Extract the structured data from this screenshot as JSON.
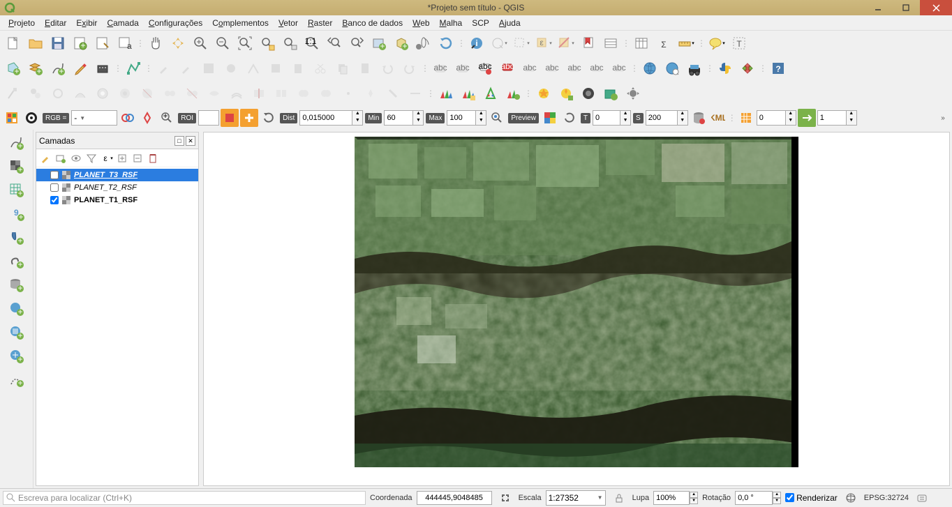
{
  "window": {
    "title": "*Projeto sem título - QGIS"
  },
  "menu": {
    "projeto": "Projeto",
    "editar": "Editar",
    "exibir": "Exibir",
    "camada": "Camada",
    "configuracoes": "Configurações",
    "complementos": "Complementos",
    "vetor": "Vetor",
    "raster": "Raster",
    "banco": "Banco de dados",
    "web": "Web",
    "malha": "Malha",
    "scp": "SCP",
    "ajuda": "Ajuda"
  },
  "scpbar": {
    "rgb_btn": "RGB =",
    "rgb_val": "-",
    "roi_btn": "ROI",
    "dist_label": "Dist",
    "dist_val": "0,015000",
    "min_label": "Min",
    "min_val": "60",
    "max_label": "Max",
    "max_val": "100",
    "preview_btn": "Preview",
    "t_label": "T",
    "t_val": "0",
    "s_label": "S",
    "s_val": "200",
    "hist_val": "0",
    "last_val": "1"
  },
  "layers_panel": {
    "title": "Camadas",
    "items": [
      {
        "name": "PLANET_T3_RSF",
        "checked": false,
        "selected": true,
        "italic": true
      },
      {
        "name": "PLANET_T2_RSF",
        "checked": false,
        "selected": false,
        "italic": true
      },
      {
        "name": "PLANET_T1_RSF",
        "checked": true,
        "selected": false,
        "italic": false
      }
    ]
  },
  "statusbar": {
    "search_placeholder": "Escreva para localizar (Ctrl+K)",
    "coord_label": "Coordenada",
    "coord_val": "444445,9048485",
    "escala_label": "Escala",
    "escala_val": "1:27352",
    "lupa_label": "Lupa",
    "lupa_val": "100%",
    "rotacao_label": "Rotação",
    "rotacao_val": "0,0 °",
    "renderizar_label": "Renderizar",
    "epsg": "EPSG:32724"
  }
}
